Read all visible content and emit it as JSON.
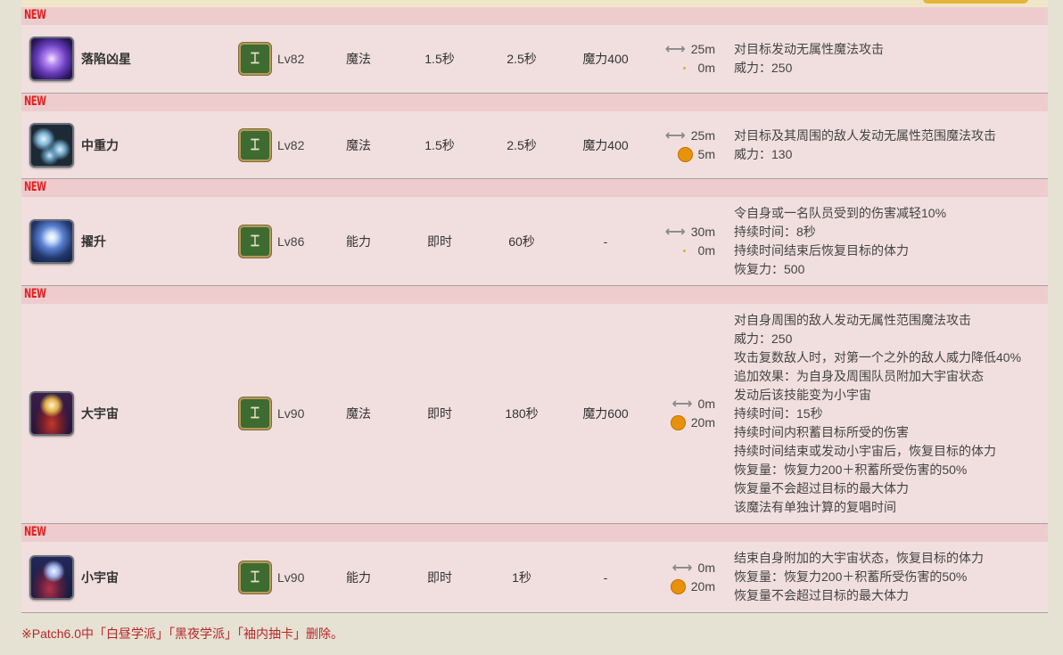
{
  "new_tag": "NEW",
  "rows": [
    {
      "icon": "falling-star-icon",
      "name": "落陷凶星",
      "job_icon": "astrologian-icon",
      "level": "Lv82",
      "type": "魔法",
      "cast": "1.5秒",
      "recast": "2.5秒",
      "cost": "魔力400",
      "range": "25m",
      "radius": "0m",
      "desc": [
        "对目标发动无属性魔法攻击",
        "威力：250"
      ]
    },
    {
      "icon": "gravity-icon",
      "name": "中重力",
      "job_icon": "astrologian-icon",
      "level": "Lv82",
      "type": "魔法",
      "cast": "1.5秒",
      "recast": "2.5秒",
      "cost": "魔力400",
      "range": "25m",
      "radius": "5m",
      "desc": [
        "对目标及其周围的敌人发动无属性范围魔法攻击",
        "威力：130"
      ]
    },
    {
      "icon": "exaltation-icon",
      "name": "擢升",
      "job_icon": "astrologian-icon",
      "level": "Lv86",
      "type": "能力",
      "cast": "即时",
      "recast": "60秒",
      "cost": "-",
      "range": "30m",
      "radius": "0m",
      "desc": [
        "令自身或一名队员受到的伤害减轻10%",
        "持续时间：8秒",
        "持续时间结束后恢复目标的体力",
        "恢复力：500"
      ]
    },
    {
      "icon": "macrocosmos-icon",
      "name": "大宇宙",
      "job_icon": "astrologian-icon",
      "level": "Lv90",
      "type": "魔法",
      "cast": "即时",
      "recast": "180秒",
      "cost": "魔力600",
      "range": "0m",
      "radius": "20m",
      "desc": [
        "对自身周围的敌人发动无属性范围魔法攻击",
        "威力：250",
        "攻击复数敌人时，对第一个之外的敌人威力降低40%",
        "追加效果：为自身及周围队员附加大宇宙状态",
        "发动后该技能变为小宇宙",
        "持续时间：15秒",
        "持续时间内积蓄目标所受的伤害",
        "持续时间结束或发动小宇宙后，恢复目标的体力",
        "恢复量：恢复力200＋积蓄所受伤害的50%",
        "恢复量不会超过目标的最大体力",
        "该魔法有单独计算的复唱时间"
      ]
    },
    {
      "icon": "microcosmos-icon",
      "name": "小宇宙",
      "job_icon": "astrologian-icon",
      "level": "Lv90",
      "type": "能力",
      "cast": "即时",
      "recast": "1秒",
      "cost": "-",
      "range": "0m",
      "radius": "20m",
      "desc": [
        "结束自身附加的大宇宙状态，恢复目标的体力",
        "恢复量：恢复力200＋积蓄所受伤害的50%",
        "恢复量不会超过目标的最大体力"
      ]
    }
  ],
  "footnote": "※Patch6.0中「白昼学派」「黑夜学派」「袖内抽卡」删除。"
}
